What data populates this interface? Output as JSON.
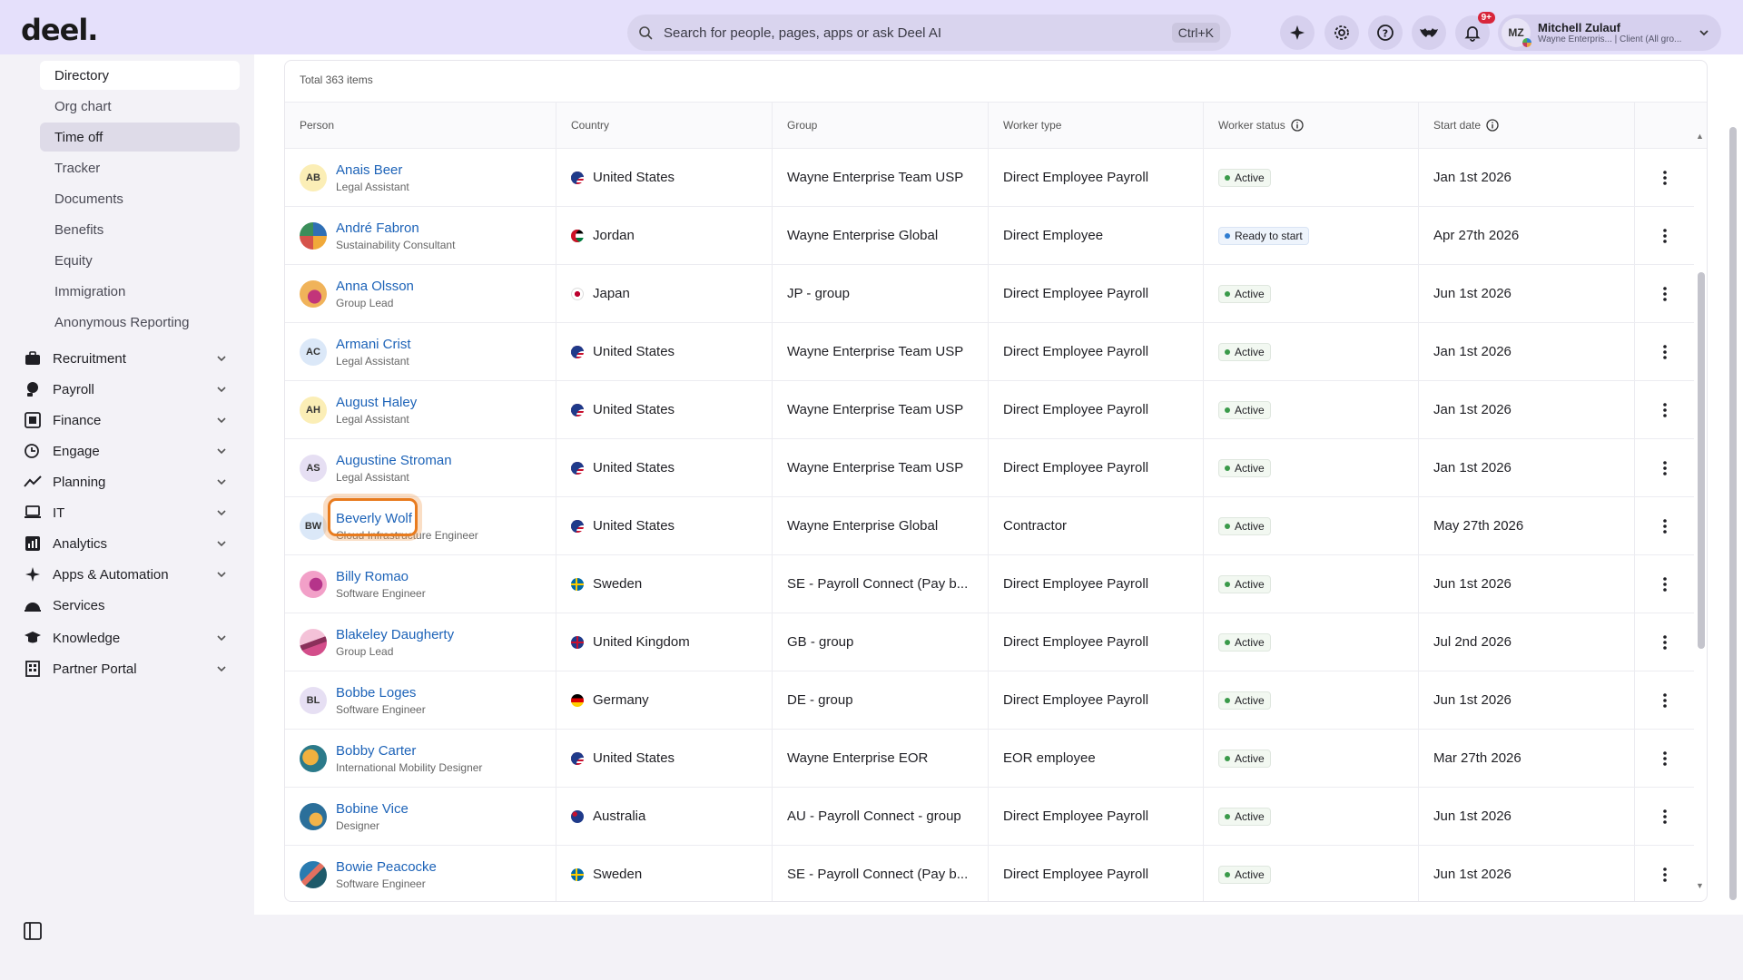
{
  "app": {
    "logo": "deel."
  },
  "search": {
    "placeholder": "Search for people, pages, apps or ask Deel AI",
    "shortcut": "Ctrl+K"
  },
  "topbar": {
    "notification_badge": "9+"
  },
  "user": {
    "initials": "MZ",
    "name": "Mitchell Zulauf",
    "subtitle": "Wayne Enterpris... | Client (All gro..."
  },
  "sidebar": {
    "sub_items": [
      "Directory",
      "Org chart",
      "Time off",
      "Tracker",
      "Documents",
      "Benefits",
      "Equity",
      "Immigration",
      "Anonymous Reporting"
    ],
    "nav_items": [
      {
        "label": "Recruitment",
        "icon": "briefcase-icon",
        "expandable": true
      },
      {
        "label": "Payroll",
        "icon": "payroll-icon",
        "expandable": true
      },
      {
        "label": "Finance",
        "icon": "finance-icon",
        "expandable": true
      },
      {
        "label": "Engage",
        "icon": "engage-icon",
        "expandable": true
      },
      {
        "label": "Planning",
        "icon": "planning-icon",
        "expandable": true
      },
      {
        "label": "IT",
        "icon": "laptop-icon",
        "expandable": true
      },
      {
        "label": "Analytics",
        "icon": "analytics-icon",
        "expandable": true
      },
      {
        "label": "Apps & Automation",
        "icon": "sparkle-icon",
        "expandable": true
      },
      {
        "label": "Services",
        "icon": "services-icon",
        "expandable": false
      },
      {
        "label": "Knowledge",
        "icon": "graduation-cap-icon",
        "expandable": true
      },
      {
        "label": "Partner Portal",
        "icon": "building-icon",
        "expandable": true
      }
    ]
  },
  "table": {
    "total": "Total 363 items",
    "columns": [
      "Person",
      "Country",
      "Group",
      "Worker type",
      "Worker status",
      "Start date"
    ],
    "rows": [
      {
        "initials": "AB",
        "name": "Anais Beer",
        "title": "Legal Assistant",
        "country": "United States",
        "flag": "us",
        "group": "Wayne Enterprise Team USP",
        "type": "Direct Employee Payroll",
        "status": "Active",
        "date": "Jan 1st 2026",
        "avatar": "initials-yellow"
      },
      {
        "initials": "",
        "name": "André Fabron",
        "title": "Sustainability Consultant",
        "country": "Jordan",
        "flag": "jo",
        "group": "Wayne Enterprise Global",
        "type": "Direct Employee",
        "status": "Ready to start",
        "date": "Apr 27th 2026",
        "avatar": "pic1"
      },
      {
        "initials": "",
        "name": "Anna Olsson",
        "title": "Group Lead",
        "country": "Japan",
        "flag": "jp",
        "group": "JP - group",
        "type": "Direct Employee Payroll",
        "status": "Active",
        "date": "Jun 1st 2026",
        "avatar": "pic2"
      },
      {
        "initials": "AC",
        "name": "Armani Crist",
        "title": "Legal Assistant",
        "country": "United States",
        "flag": "us",
        "group": "Wayne Enterprise Team USP",
        "type": "Direct Employee Payroll",
        "status": "Active",
        "date": "Jan 1st 2026",
        "avatar": "initials-blue"
      },
      {
        "initials": "AH",
        "name": "August Haley",
        "title": "Legal Assistant",
        "country": "United States",
        "flag": "us",
        "group": "Wayne Enterprise Team USP",
        "type": "Direct Employee Payroll",
        "status": "Active",
        "date": "Jan 1st 2026",
        "avatar": "initials-yellow"
      },
      {
        "initials": "AS",
        "name": "Augustine Stroman",
        "title": "Legal Assistant",
        "country": "United States",
        "flag": "us",
        "group": "Wayne Enterprise Team USP",
        "type": "Direct Employee Payroll",
        "status": "Active",
        "date": "Jan 1st 2026",
        "avatar": "initials-lilac"
      },
      {
        "initials": "BW",
        "name": "Beverly Wolf",
        "title": "Cloud Infrastructure Engineer",
        "country": "United States",
        "flag": "us",
        "group": "Wayne Enterprise Global",
        "type": "Contractor",
        "status": "Active",
        "date": "May 27th 2026",
        "avatar": "initials-blue"
      },
      {
        "initials": "",
        "name": "Billy Romao",
        "title": "Software Engineer",
        "country": "Sweden",
        "flag": "se",
        "group": "SE - Payroll Connect (Pay b...",
        "type": "Direct Employee Payroll",
        "status": "Active",
        "date": "Jun 1st 2026",
        "avatar": "pic3"
      },
      {
        "initials": "",
        "name": "Blakeley Daugherty",
        "title": "Group Lead",
        "country": "United Kingdom",
        "flag": "gb",
        "group": "GB - group",
        "type": "Direct Employee Payroll",
        "status": "Active",
        "date": "Jul 2nd 2026",
        "avatar": "pic4"
      },
      {
        "initials": "BL",
        "name": "Bobbe Loges",
        "title": "Software Engineer",
        "country": "Germany",
        "flag": "de",
        "group": "DE - group",
        "type": "Direct Employee Payroll",
        "status": "Active",
        "date": "Jun 1st 2026",
        "avatar": "initials-lilac"
      },
      {
        "initials": "",
        "name": "Bobby Carter",
        "title": "International Mobility Designer",
        "country": "United States",
        "flag": "us",
        "group": "Wayne Enterprise EOR",
        "type": "EOR employee",
        "status": "Active",
        "date": "Mar 27th 2026",
        "avatar": "pic5"
      },
      {
        "initials": "",
        "name": "Bobine Vice",
        "title": "Designer",
        "country": "Australia",
        "flag": "au",
        "group": "AU - Payroll Connect - group",
        "type": "Direct Employee Payroll",
        "status": "Active",
        "date": "Jun 1st 2026",
        "avatar": "pic6"
      },
      {
        "initials": "",
        "name": "Bowie Peacocke",
        "title": "Software Engineer",
        "country": "Sweden",
        "flag": "se",
        "group": "SE - Payroll Connect (Pay b...",
        "type": "Direct Employee Payroll",
        "status": "Active",
        "date": "Jun 1st 2026",
        "avatar": "pic7"
      }
    ]
  }
}
